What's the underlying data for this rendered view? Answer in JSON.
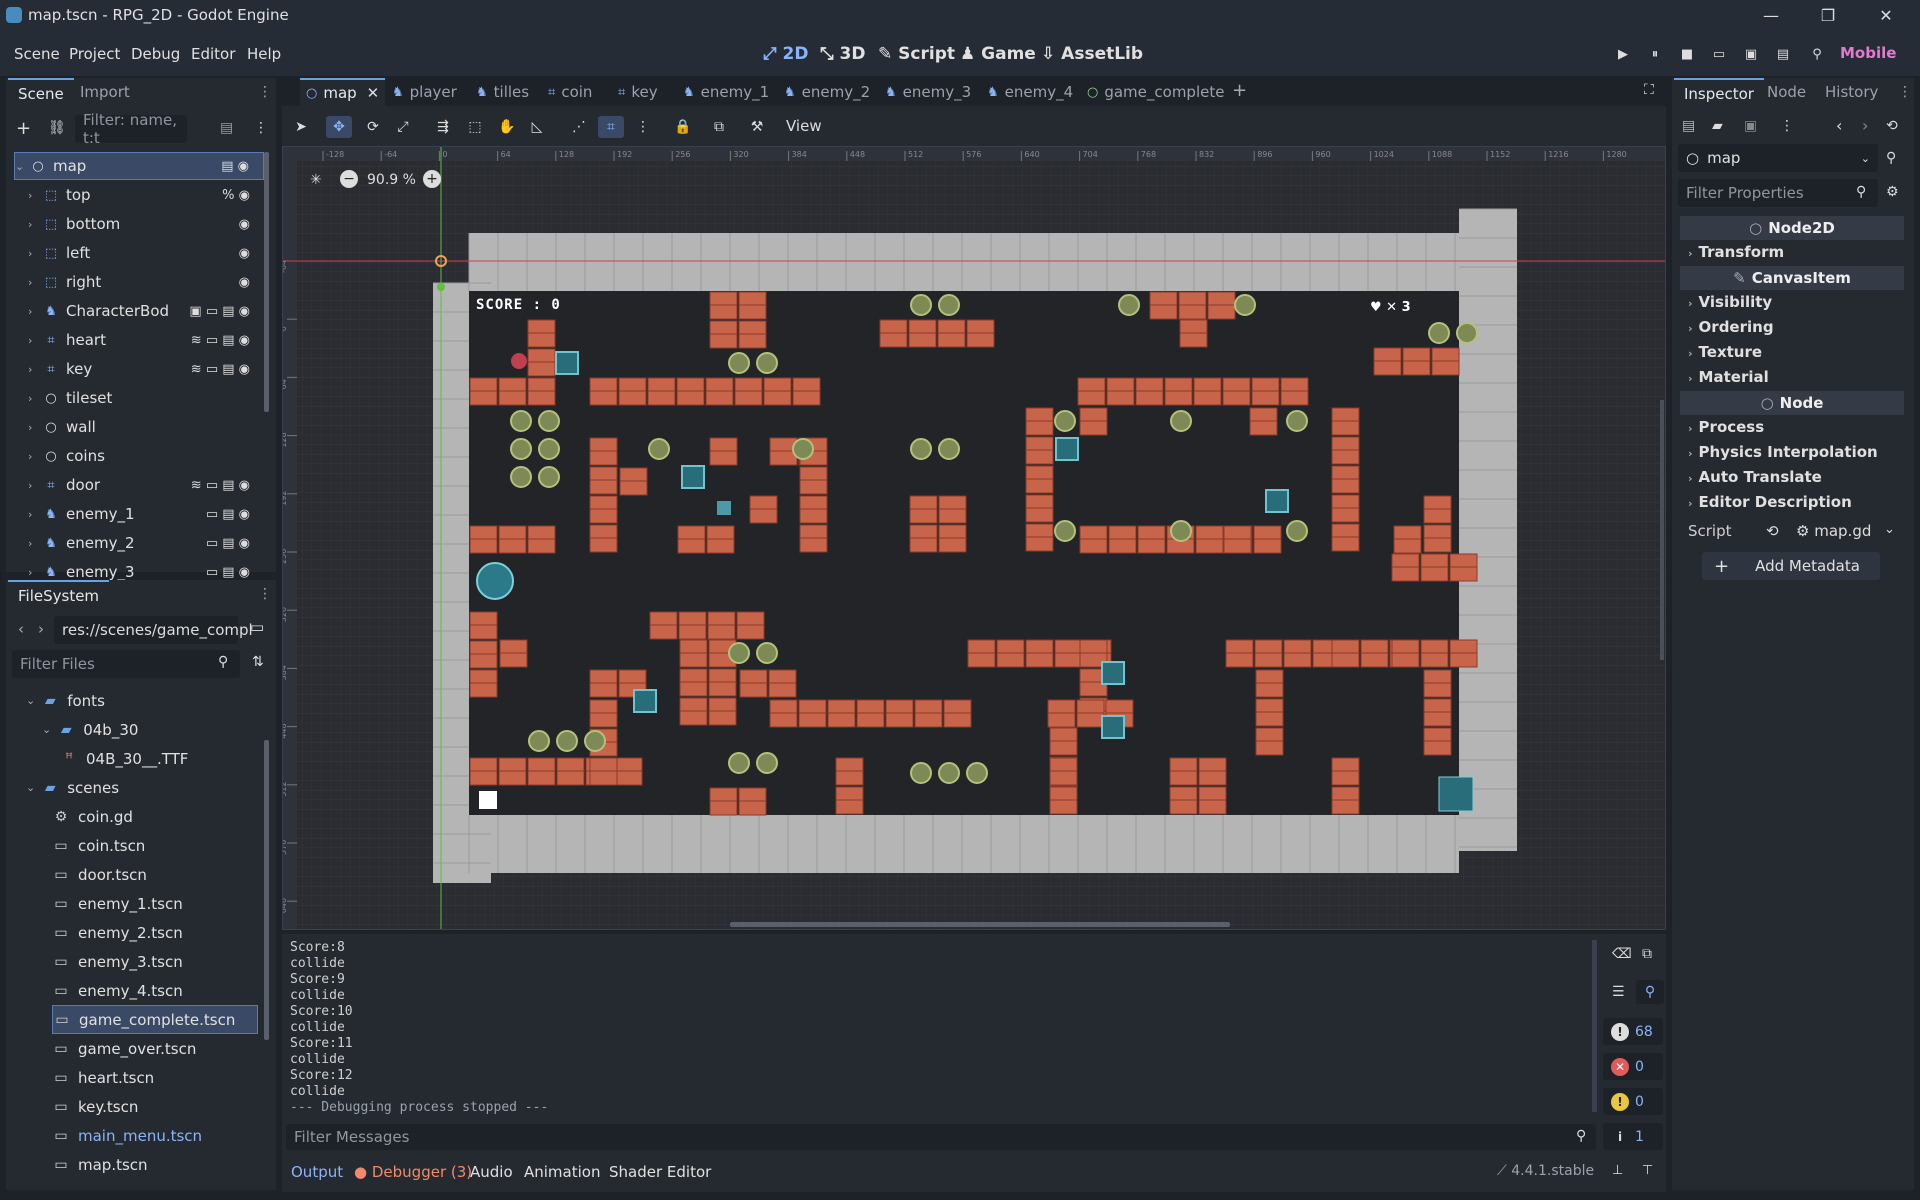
{
  "window": {
    "title": "map.tscn - RPG_2D - Godot Engine",
    "minimize": "—",
    "restore": "❐",
    "close": "✕"
  },
  "menus": [
    "Scene",
    "Project",
    "Debug",
    "Editor",
    "Help"
  ],
  "workspaces": [
    {
      "label": "2D",
      "icon": "⤢"
    },
    {
      "label": "3D",
      "icon": "⤡"
    },
    {
      "label": "Script",
      "icon": "✎"
    },
    {
      "label": "Game",
      "icon": "♟"
    },
    {
      "label": "AssetLib",
      "icon": "⇩"
    }
  ],
  "renderer": "Mobile",
  "run_buttons": [
    "▶",
    "⏸",
    "■",
    "▭",
    "▣",
    "▤",
    "⚲"
  ],
  "scene_dock": {
    "tabs": [
      "Scene",
      "Import"
    ],
    "filter_placeholder": "Filter: name, t:t",
    "nodes": [
      {
        "name": "map",
        "icon": "○",
        "color": "#dcdcdc",
        "selected": true,
        "indent": 0,
        "icons": "▤ ◉"
      },
      {
        "name": "top",
        "icon": "⬚",
        "color": "#8ab4f8",
        "indent": 1,
        "icons": "% ◉"
      },
      {
        "name": "bottom",
        "icon": "⬚",
        "color": "#8ab4f8",
        "indent": 1,
        "icons": "◉"
      },
      {
        "name": "left",
        "icon": "⬚",
        "color": "#8ab4f8",
        "indent": 1,
        "icons": "◉"
      },
      {
        "name": "right",
        "icon": "⬚",
        "color": "#8ab4f8",
        "indent": 1,
        "icons": "◉"
      },
      {
        "name": "CharacterBod",
        "icon": "♞",
        "color": "#8ab4f8",
        "indent": 1,
        "icons": "▣ ▭ ▤ ◉"
      },
      {
        "name": "heart",
        "icon": "⌗",
        "color": "#8ab4f8",
        "indent": 1,
        "icons": "≋ ▭ ▤ ◉"
      },
      {
        "name": "key",
        "icon": "⌗",
        "color": "#8ab4f8",
        "indent": 1,
        "icons": "≋ ▭ ▤ ◉"
      },
      {
        "name": "tileset",
        "icon": "○",
        "color": "#dcdcdc",
        "indent": 1,
        "icons": ""
      },
      {
        "name": "wall",
        "icon": "○",
        "color": "#dcdcdc",
        "indent": 1,
        "icons": ""
      },
      {
        "name": "coins",
        "icon": "○",
        "color": "#dcdcdc",
        "indent": 1,
        "icons": ""
      },
      {
        "name": "door",
        "icon": "⌗",
        "color": "#8ab4f8",
        "indent": 1,
        "icons": "≋ ▭ ▤ ◉"
      },
      {
        "name": "enemy_1",
        "icon": "♞",
        "color": "#8ab4f8",
        "indent": 1,
        "icons": "▭ ▤ ◉"
      },
      {
        "name": "enemy_2",
        "icon": "♞",
        "color": "#8ab4f8",
        "indent": 1,
        "icons": "▭ ▤ ◉"
      },
      {
        "name": "enemy_3",
        "icon": "♞",
        "color": "#8ab4f8",
        "indent": 1,
        "icons": "▭ ▤ ◉"
      }
    ]
  },
  "filesystem": {
    "tab": "FileSystem",
    "path": "res://scenes/game_compl",
    "filter_placeholder": "Filter Files",
    "items": [
      {
        "name": "fonts",
        "type": "folder",
        "indent": 1
      },
      {
        "name": "04b_30",
        "type": "folder",
        "indent": 2
      },
      {
        "name": "04B_30__.TTF",
        "type": "font",
        "indent": 3
      },
      {
        "name": "scenes",
        "type": "folder",
        "indent": 1
      },
      {
        "name": "coin.gd",
        "type": "script",
        "indent": 2
      },
      {
        "name": "coin.tscn",
        "type": "scene",
        "indent": 2
      },
      {
        "name": "door.tscn",
        "type": "scene",
        "indent": 2
      },
      {
        "name": "enemy_1.tscn",
        "type": "scene",
        "indent": 2
      },
      {
        "name": "enemy_2.tscn",
        "type": "scene",
        "indent": 2
      },
      {
        "name": "enemy_3.tscn",
        "type": "scene",
        "indent": 2
      },
      {
        "name": "enemy_4.tscn",
        "type": "scene",
        "indent": 2
      },
      {
        "name": "game_complete.tscn",
        "type": "scene",
        "indent": 2,
        "selected": true
      },
      {
        "name": "game_over.tscn",
        "type": "scene",
        "indent": 2
      },
      {
        "name": "heart.tscn",
        "type": "scene",
        "indent": 2
      },
      {
        "name": "key.tscn",
        "type": "scene",
        "indent": 2
      },
      {
        "name": "main_menu.tscn",
        "type": "scene",
        "indent": 2,
        "highlight": true
      },
      {
        "name": "map.tscn",
        "type": "scene",
        "indent": 2
      }
    ]
  },
  "scene_tabs": [
    {
      "label": "map",
      "icon": "○",
      "active": true
    },
    {
      "label": "player",
      "icon": "♞"
    },
    {
      "label": "tilles",
      "icon": "♞"
    },
    {
      "label": "coin",
      "icon": "⌗"
    },
    {
      "label": "key",
      "icon": "⌗"
    },
    {
      "label": "enemy_1",
      "icon": "♞"
    },
    {
      "label": "enemy_2",
      "icon": "♞"
    },
    {
      "label": "enemy_3",
      "icon": "♞"
    },
    {
      "label": "enemy_4",
      "icon": "♞"
    },
    {
      "label": "game_complete",
      "icon": "○",
      "green": true
    }
  ],
  "toolbar": {
    "tools": [
      "➤",
      "✥",
      "⟳",
      "⤢",
      "⇶",
      "⬚",
      "✋",
      "◺",
      "⋰",
      "⌗",
      "⋮",
      "🔒",
      "⧉",
      "⚒"
    ],
    "view_label": "View"
  },
  "viewport": {
    "zoom": "90.9 %",
    "zoom_out": "−",
    "zoom_in": "+",
    "ruler_x": [
      "-128",
      "-64",
      "0",
      "64",
      "128",
      "192",
      "256",
      "320",
      "384",
      "448",
      "512",
      "576",
      "640",
      "704",
      "768",
      "832",
      "896",
      "960",
      "1024",
      "1088",
      "1152",
      "1216",
      "1280"
    ],
    "ruler_y": [
      "-64",
      "0",
      "64",
      "128",
      "192",
      "256",
      "320",
      "384",
      "448",
      "512",
      "576",
      "640",
      "704"
    ],
    "hud": {
      "score": "SCORE : 0",
      "lives": "♥ ✕ 3"
    }
  },
  "output": {
    "lines": [
      "Score:8",
      "collide",
      "Score:9",
      "collide",
      "Score:10",
      "collide",
      "Score:11",
      "collide",
      "Score:12",
      "collide",
      "--- Debugging process stopped ---"
    ],
    "filter_placeholder": "Filter Messages",
    "counts": {
      "messages": "68",
      "errors": "0",
      "warnings": "0",
      "info": "1"
    }
  },
  "bottom_tabs": [
    "Output",
    "Debugger (3)",
    "Audio",
    "Animation",
    "Shader Editor"
  ],
  "version": "4.4.1.stable",
  "inspector": {
    "tabs": [
      "Inspector",
      "Node",
      "History"
    ],
    "object": "map",
    "filter_placeholder": "Filter Properties",
    "sections": [
      {
        "kind": "class",
        "label": "Node2D",
        "icon": "○"
      },
      {
        "kind": "group",
        "label": "Transform"
      },
      {
        "kind": "class",
        "label": "CanvasItem",
        "icon": "✎"
      },
      {
        "kind": "group",
        "label": "Visibility"
      },
      {
        "kind": "group",
        "label": "Ordering"
      },
      {
        "kind": "group",
        "label": "Texture"
      },
      {
        "kind": "group",
        "label": "Material"
      },
      {
        "kind": "class",
        "label": "Node",
        "icon": "○"
      },
      {
        "kind": "group",
        "label": "Process"
      },
      {
        "kind": "group",
        "label": "Physics Interpolation"
      },
      {
        "kind": "group",
        "label": "Auto Translate"
      },
      {
        "kind": "group",
        "label": "Editor Description"
      }
    ],
    "script_label": "Script",
    "script_value": "map.gd",
    "add_metadata": "Add Metadata"
  },
  "colors": {
    "accent": "#6aa2e8",
    "brick": "#c8644a",
    "wall": "#b5b5b5",
    "floor": "#222428",
    "coin": "#7d8a55",
    "bg": "#1d2229"
  }
}
